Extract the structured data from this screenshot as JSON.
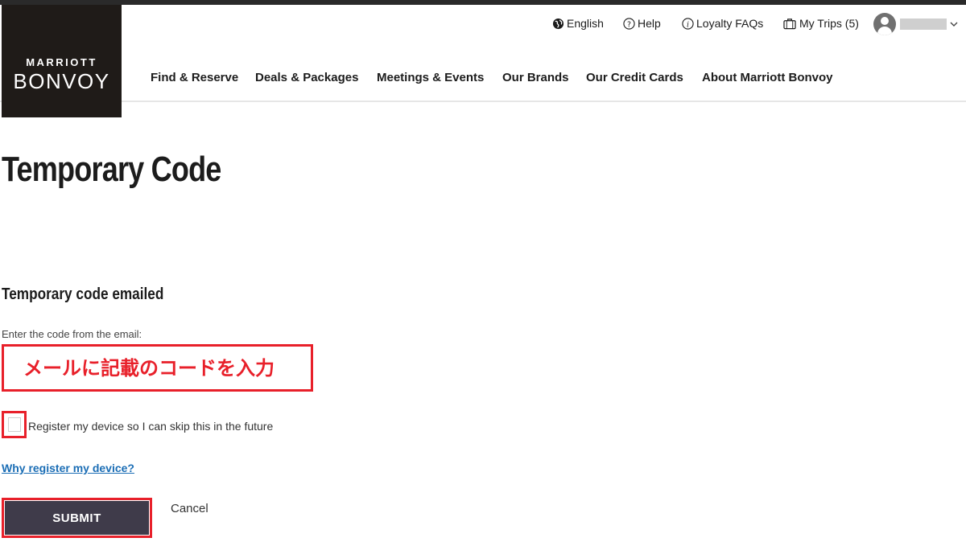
{
  "header": {
    "logo_top": "MARRIOTT",
    "logo_bottom": "BONVOY",
    "utility": {
      "language": "English",
      "help": "Help",
      "loyalty_faqs": "Loyalty FAQs",
      "my_trips": "My Trips (5)"
    },
    "nav": [
      {
        "label": "Find & Reserve"
      },
      {
        "label": "Deals & Packages"
      },
      {
        "label": "Meetings & Events"
      },
      {
        "label": "Our Brands"
      },
      {
        "label": "Our Credit Cards"
      },
      {
        "label": "About Marriott Bonvoy"
      }
    ],
    "icons": [
      "globe-icon",
      "help-icon",
      "info-icon",
      "suitcase-icon",
      "avatar-icon",
      "chevron-down-icon"
    ]
  },
  "main": {
    "title": "Temporary Code",
    "section_heading": "Temporary code emailed",
    "field_label": "Enter the code from the email:",
    "code_input": {
      "value": "",
      "placeholder": "メールに記載のコードを入力"
    },
    "register_checkbox": {
      "label": "Register my device so I can skip this in the future",
      "checked": false
    },
    "why_link": "Why register my device?",
    "submit_label": "SUBMIT",
    "cancel_label": "Cancel"
  },
  "colors": {
    "brand_dark": "#1f1b18",
    "submit_bg": "#3f3b4a",
    "link": "#1a6db5",
    "annotation_red": "#e8202a"
  }
}
